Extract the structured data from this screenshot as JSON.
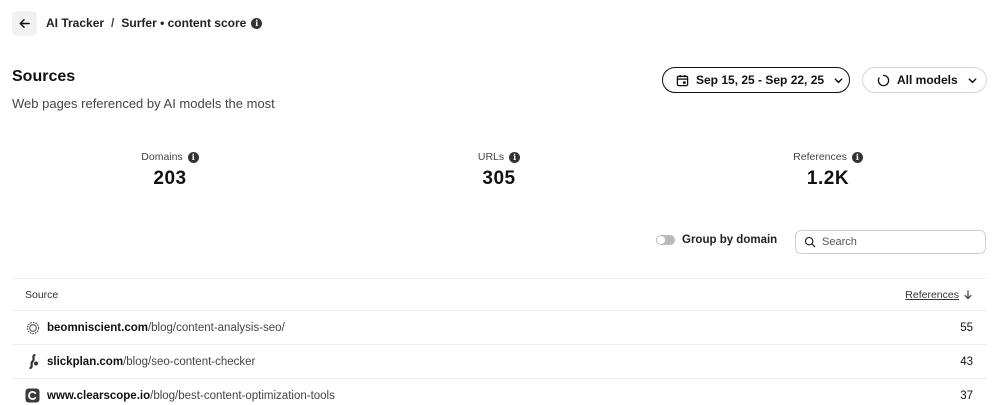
{
  "breadcrumb": {
    "root": "AI Tracker",
    "separator": "/",
    "current": "Surfer • content score"
  },
  "header": {
    "title": "Sources",
    "subtitle": "Web pages referenced by AI models the most"
  },
  "filters": {
    "date_range": "Sep 15, 25 - Sep 22, 25",
    "models": "All models"
  },
  "stats": [
    {
      "label": "Domains",
      "value": "203"
    },
    {
      "label": "URLs",
      "value": "305"
    },
    {
      "label": "References",
      "value": "1.2K"
    }
  ],
  "controls": {
    "group_by_domain": "Group by domain",
    "group_by_domain_on": false,
    "search_placeholder": "Search"
  },
  "table": {
    "col_source": "Source",
    "col_references": "References",
    "rows": [
      {
        "domain": "beomniscient.com",
        "path": "/blog/content-analysis-seo/",
        "references": "55",
        "favicon": "omniscient-icon"
      },
      {
        "domain": "slickplan.com",
        "path": "/blog/seo-content-checker",
        "references": "43",
        "favicon": "slickplan-icon"
      },
      {
        "domain": "www.clearscope.io",
        "path": "/blog/best-content-optimization-tools",
        "references": "37",
        "favicon": "clearscope-icon"
      }
    ]
  },
  "colors": {
    "text": "#111111",
    "muted": "#444444",
    "border": "#ededed",
    "toggle_off": "#b9b9b9"
  }
}
